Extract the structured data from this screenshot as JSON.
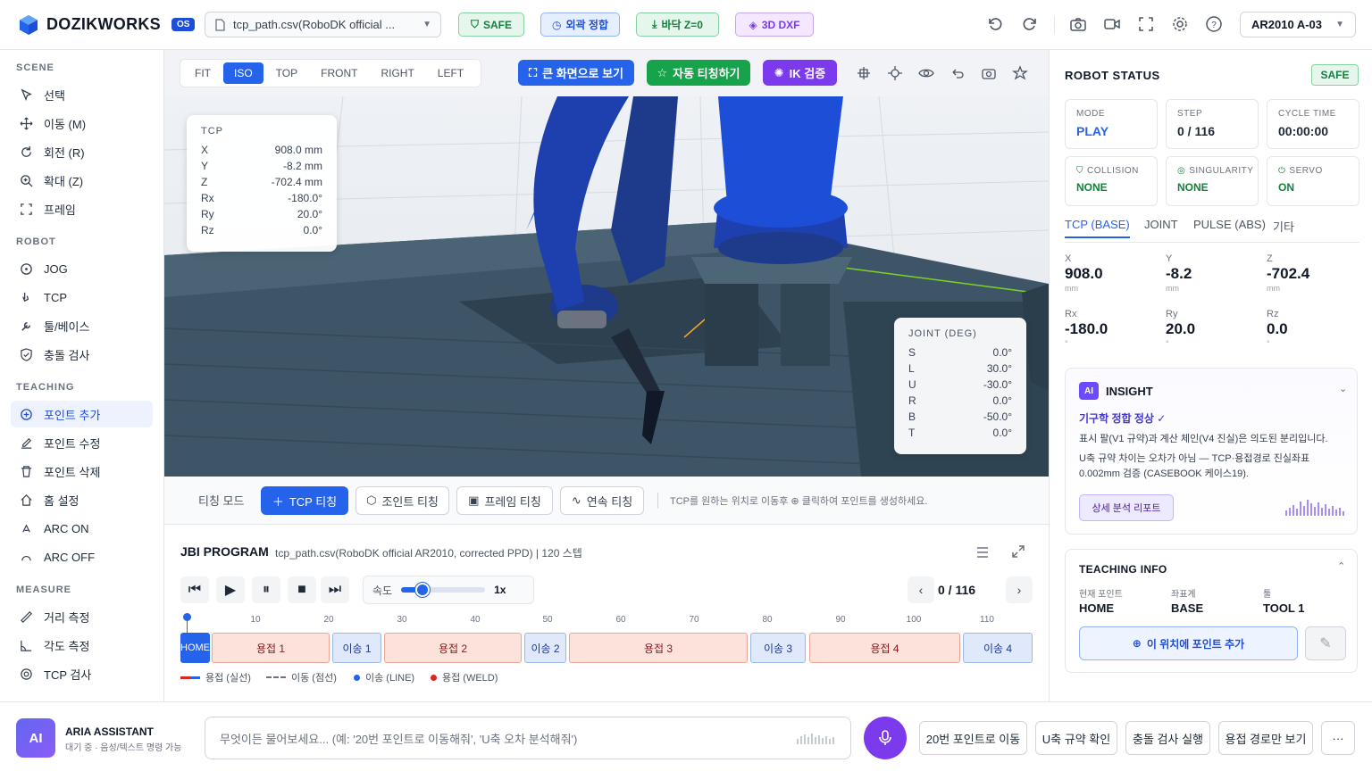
{
  "header": {
    "brand": "DOZIKWORKS",
    "version": "OS",
    "file_name": "tcp_path.csv(RoboDK official ...",
    "status_pills": [
      {
        "label": "SAFE",
        "color": "#15803d"
      },
      {
        "label": "외곽 정합",
        "color": "#1d4ed8"
      },
      {
        "label": "바닥 Z=0",
        "color": "#15803d"
      },
      {
        "label": "3D DXF",
        "color": "#7c3aed"
      }
    ],
    "robot_select": "AR2010 A-03"
  },
  "sidebar": {
    "scene_title": "SCENE",
    "scene_items": [
      "선택",
      "이동 (M)",
      "회전 (R)",
      "확대 (Z)",
      "프레임"
    ],
    "robot_title": "ROBOT",
    "robot_items": [
      "JOG",
      "TCP",
      "툴/베이스",
      "충돌 검사"
    ],
    "teaching_title": "TEACHING",
    "teaching_items": [
      "포인트 추가",
      "포인트 수정",
      "포인트 삭제",
      "홈 설정",
      "ARC ON",
      "ARC OFF"
    ],
    "measure_title": "MEASURE",
    "measure_items": [
      "거리 측정",
      "각도 측정",
      "TCP 검사"
    ]
  },
  "viewport": {
    "views": [
      "FIT",
      "ISO",
      "TOP",
      "FRONT",
      "RIGHT",
      "LEFT"
    ],
    "active_view": "ISO",
    "fullscreen_label": "큰 화면으로 보기",
    "auto_teach_label": "자동 티칭하기",
    "ik_label": "IK 검증",
    "tcp_overlay": {
      "title": "TCP",
      "rows": [
        {
          "k": "X",
          "v": "908.0 mm"
        },
        {
          "k": "Y",
          "v": "-8.2 mm"
        },
        {
          "k": "Z",
          "v": "-702.4 mm"
        },
        {
          "k": "Rx",
          "v": "-180.0°"
        },
        {
          "k": "Ry",
          "v": "20.0°"
        },
        {
          "k": "Rz",
          "v": "0.0°"
        }
      ]
    },
    "joint_overlay": {
      "title": "JOINT (DEG)",
      "rows": [
        {
          "k": "S",
          "v": "0.0°"
        },
        {
          "k": "L",
          "v": "30.0°"
        },
        {
          "k": "U",
          "v": "-30.0°"
        },
        {
          "k": "R",
          "v": "0.0°"
        },
        {
          "k": "B",
          "v": "-50.0°"
        },
        {
          "k": "T",
          "v": "0.0°"
        }
      ]
    }
  },
  "teach_bar": {
    "mode_label": "티칭 모드",
    "buttons": [
      "TCP 티칭",
      "조인트 티칭",
      "프레임 티칭",
      "연속 티칭"
    ],
    "hint": "TCP를 원하는 위치로 이동후 ⊕ 클릭하여 포인트를 생성하세요."
  },
  "program": {
    "title": "JBI PROGRAM",
    "subtitle": "tcp_path.csv(RoboDK official AR2010, corrected PPD) | 120 스텝",
    "speed_label": "속도",
    "speed_value": "1x",
    "speed_fraction": 0.25,
    "step_counter": "0 / 116",
    "ticks": [
      "10",
      "20",
      "30",
      "40",
      "50",
      "60",
      "70",
      "80",
      "90",
      "100",
      "110"
    ],
    "segments": [
      "HOME",
      "용접 1",
      "이송 1",
      "용접 2",
      "이송 2",
      "용접 3",
      "이송 3",
      "용접 4",
      "이송 4"
    ],
    "legend": [
      "용접 (실선)",
      "이동 (점선)",
      "이송 (LINE)",
      "용접 (WELD)"
    ]
  },
  "robot_status": {
    "title": "ROBOT STATUS",
    "badge": "SAFE",
    "cards": [
      {
        "label": "MODE",
        "value": "PLAY",
        "color": "#2563eb"
      },
      {
        "label": "STEP",
        "value": "0 / 116",
        "color": "#111827"
      },
      {
        "label": "CYCLE TIME",
        "value": "00:00:00",
        "color": "#111827"
      },
      {
        "label": "COLLISION",
        "value": "NONE",
        "color": "#15803d"
      },
      {
        "label": "SINGULARITY",
        "value": "NONE",
        "color": "#15803d"
      },
      {
        "label": "SERVO",
        "value": "ON",
        "color": "#15803d"
      }
    ],
    "tabs": [
      "TCP (BASE)",
      "JOINT",
      "PULSE (ABS)",
      "기타"
    ],
    "coords": [
      {
        "label": "X",
        "value": "908.0",
        "unit": "mm"
      },
      {
        "label": "Y",
        "value": "-8.2",
        "unit": "mm"
      },
      {
        "label": "Z",
        "value": "-702.4",
        "unit": "mm"
      },
      {
        "label": "Rx",
        "value": "-180.0",
        "unit": "°"
      },
      {
        "label": "Ry",
        "value": "20.0",
        "unit": "°"
      },
      {
        "label": "Rz",
        "value": "0.0",
        "unit": "°"
      }
    ]
  },
  "insight": {
    "badge": "AI",
    "title": "INSIGHT",
    "headline": "기구학 정합 정상 ✓",
    "line1": "표시 팔(V1 규약)과 계산 체인(V4 진실)은 의도된 분리입니다.",
    "line2": "U축 규약 차이는 오차가 아님 — TCP·용접경로 진실좌표 0.002mm 검증 (CASEBOOK 케이스19).",
    "report_btn": "상세 분석 리포트"
  },
  "teaching_info": {
    "title": "TEACHING INFO",
    "labels": [
      "현재 포인트",
      "좌표계",
      "툴"
    ],
    "values": [
      "HOME",
      "BASE",
      "TOOL 1"
    ],
    "add_btn": "이 위치에 포인트 추가"
  },
  "assistant": {
    "avatar": "AI",
    "name": "ARIA ASSISTANT",
    "status": "대기 중 · 음성/텍스트 명령 가능",
    "placeholder": "무엇이든 물어보세요... (예: '20번 포인트로 이동해줘', 'U축 오차 분석해줘')",
    "quick": [
      "20번 포인트로 이동",
      "U축 규약 확인",
      "충돌 검사 실행",
      "용접 경로만 보기"
    ],
    "more": "···"
  }
}
